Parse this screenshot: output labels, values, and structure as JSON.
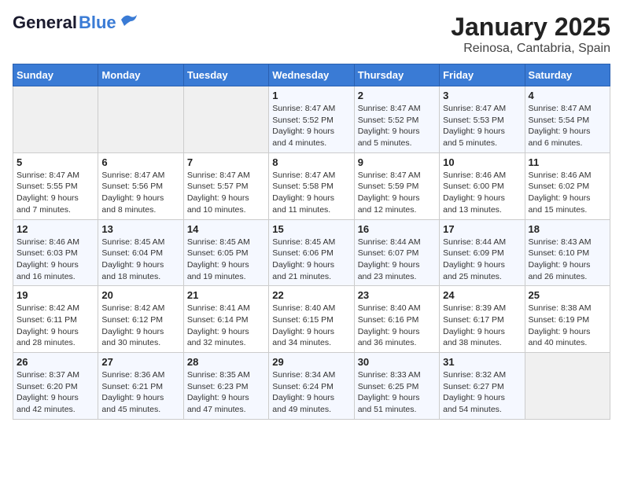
{
  "header": {
    "logo_general": "General",
    "logo_blue": "Blue",
    "title": "January 2025",
    "subtitle": "Reinosa, Cantabria, Spain"
  },
  "weekdays": [
    "Sunday",
    "Monday",
    "Tuesday",
    "Wednesday",
    "Thursday",
    "Friday",
    "Saturday"
  ],
  "weeks": [
    [
      {
        "day": "",
        "info": ""
      },
      {
        "day": "",
        "info": ""
      },
      {
        "day": "",
        "info": ""
      },
      {
        "day": "1",
        "info": "Sunrise: 8:47 AM\nSunset: 5:52 PM\nDaylight: 9 hours\nand 4 minutes."
      },
      {
        "day": "2",
        "info": "Sunrise: 8:47 AM\nSunset: 5:52 PM\nDaylight: 9 hours\nand 5 minutes."
      },
      {
        "day": "3",
        "info": "Sunrise: 8:47 AM\nSunset: 5:53 PM\nDaylight: 9 hours\nand 5 minutes."
      },
      {
        "day": "4",
        "info": "Sunrise: 8:47 AM\nSunset: 5:54 PM\nDaylight: 9 hours\nand 6 minutes."
      }
    ],
    [
      {
        "day": "5",
        "info": "Sunrise: 8:47 AM\nSunset: 5:55 PM\nDaylight: 9 hours\nand 7 minutes."
      },
      {
        "day": "6",
        "info": "Sunrise: 8:47 AM\nSunset: 5:56 PM\nDaylight: 9 hours\nand 8 minutes."
      },
      {
        "day": "7",
        "info": "Sunrise: 8:47 AM\nSunset: 5:57 PM\nDaylight: 9 hours\nand 10 minutes."
      },
      {
        "day": "8",
        "info": "Sunrise: 8:47 AM\nSunset: 5:58 PM\nDaylight: 9 hours\nand 11 minutes."
      },
      {
        "day": "9",
        "info": "Sunrise: 8:47 AM\nSunset: 5:59 PM\nDaylight: 9 hours\nand 12 minutes."
      },
      {
        "day": "10",
        "info": "Sunrise: 8:46 AM\nSunset: 6:00 PM\nDaylight: 9 hours\nand 13 minutes."
      },
      {
        "day": "11",
        "info": "Sunrise: 8:46 AM\nSunset: 6:02 PM\nDaylight: 9 hours\nand 15 minutes."
      }
    ],
    [
      {
        "day": "12",
        "info": "Sunrise: 8:46 AM\nSunset: 6:03 PM\nDaylight: 9 hours\nand 16 minutes."
      },
      {
        "day": "13",
        "info": "Sunrise: 8:45 AM\nSunset: 6:04 PM\nDaylight: 9 hours\nand 18 minutes."
      },
      {
        "day": "14",
        "info": "Sunrise: 8:45 AM\nSunset: 6:05 PM\nDaylight: 9 hours\nand 19 minutes."
      },
      {
        "day": "15",
        "info": "Sunrise: 8:45 AM\nSunset: 6:06 PM\nDaylight: 9 hours\nand 21 minutes."
      },
      {
        "day": "16",
        "info": "Sunrise: 8:44 AM\nSunset: 6:07 PM\nDaylight: 9 hours\nand 23 minutes."
      },
      {
        "day": "17",
        "info": "Sunrise: 8:44 AM\nSunset: 6:09 PM\nDaylight: 9 hours\nand 25 minutes."
      },
      {
        "day": "18",
        "info": "Sunrise: 8:43 AM\nSunset: 6:10 PM\nDaylight: 9 hours\nand 26 minutes."
      }
    ],
    [
      {
        "day": "19",
        "info": "Sunrise: 8:42 AM\nSunset: 6:11 PM\nDaylight: 9 hours\nand 28 minutes."
      },
      {
        "day": "20",
        "info": "Sunrise: 8:42 AM\nSunset: 6:12 PM\nDaylight: 9 hours\nand 30 minutes."
      },
      {
        "day": "21",
        "info": "Sunrise: 8:41 AM\nSunset: 6:14 PM\nDaylight: 9 hours\nand 32 minutes."
      },
      {
        "day": "22",
        "info": "Sunrise: 8:40 AM\nSunset: 6:15 PM\nDaylight: 9 hours\nand 34 minutes."
      },
      {
        "day": "23",
        "info": "Sunrise: 8:40 AM\nSunset: 6:16 PM\nDaylight: 9 hours\nand 36 minutes."
      },
      {
        "day": "24",
        "info": "Sunrise: 8:39 AM\nSunset: 6:17 PM\nDaylight: 9 hours\nand 38 minutes."
      },
      {
        "day": "25",
        "info": "Sunrise: 8:38 AM\nSunset: 6:19 PM\nDaylight: 9 hours\nand 40 minutes."
      }
    ],
    [
      {
        "day": "26",
        "info": "Sunrise: 8:37 AM\nSunset: 6:20 PM\nDaylight: 9 hours\nand 42 minutes."
      },
      {
        "day": "27",
        "info": "Sunrise: 8:36 AM\nSunset: 6:21 PM\nDaylight: 9 hours\nand 45 minutes."
      },
      {
        "day": "28",
        "info": "Sunrise: 8:35 AM\nSunset: 6:23 PM\nDaylight: 9 hours\nand 47 minutes."
      },
      {
        "day": "29",
        "info": "Sunrise: 8:34 AM\nSunset: 6:24 PM\nDaylight: 9 hours\nand 49 minutes."
      },
      {
        "day": "30",
        "info": "Sunrise: 8:33 AM\nSunset: 6:25 PM\nDaylight: 9 hours\nand 51 minutes."
      },
      {
        "day": "31",
        "info": "Sunrise: 8:32 AM\nSunset: 6:27 PM\nDaylight: 9 hours\nand 54 minutes."
      },
      {
        "day": "",
        "info": ""
      }
    ]
  ]
}
